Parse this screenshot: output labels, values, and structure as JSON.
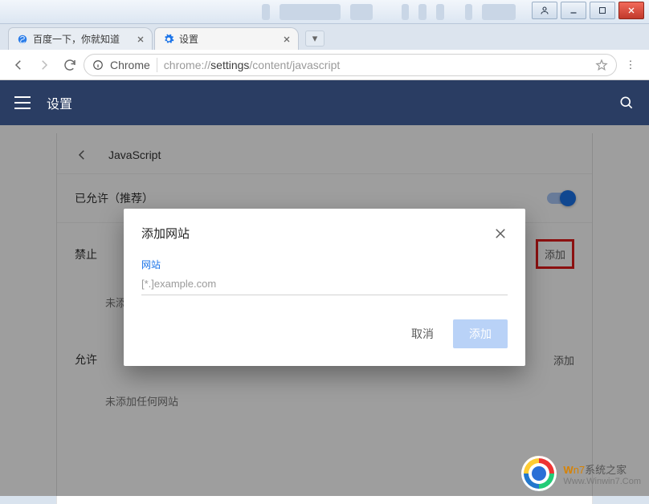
{
  "window": {
    "user_button_title": "User"
  },
  "tabs": {
    "tab1_title": "百度一下，你就知道",
    "tab2_title": "设置"
  },
  "omnibox": {
    "scheme_label": "Chrome",
    "url_prefix": "chrome://",
    "url_bold": "settings",
    "url_suffix": "/content/javascript"
  },
  "settings": {
    "header_title": "设置",
    "page_heading": "JavaScript",
    "allowed_label": "已允许（推荐）",
    "block_section": "禁止",
    "block_empty": "未添加任何网站",
    "block_add": "添加",
    "allow_section": "允许",
    "allow_empty": "未添加任何网站",
    "allow_add": "添加"
  },
  "dialog": {
    "title": "添加网站",
    "field_label": "网站",
    "placeholder": "[*.]example.com",
    "cancel": "取消",
    "confirm": "添加"
  },
  "watermark": {
    "line1_a": "W",
    "line1_b": "n7",
    "line1_c": "系统之家",
    "line2": "Www.Winwin7.Com"
  }
}
